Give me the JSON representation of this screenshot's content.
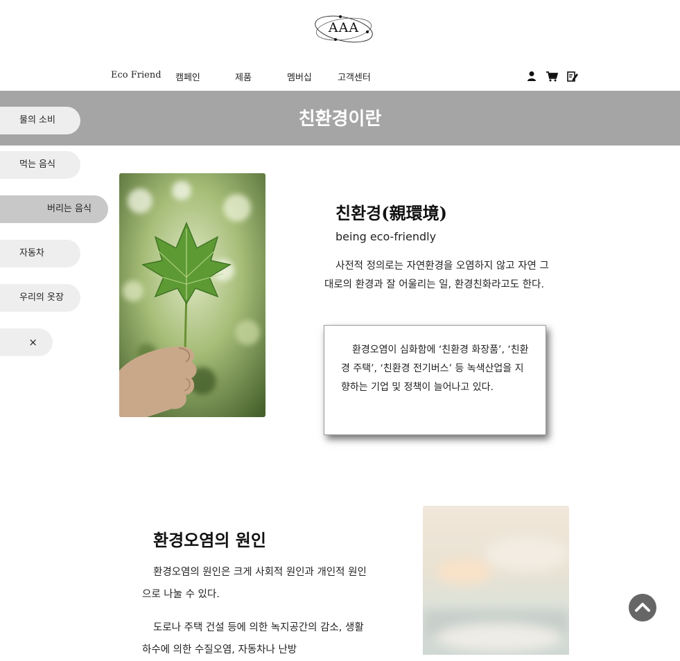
{
  "brand": {
    "logo_text": "AAA"
  },
  "nav": {
    "items": [
      {
        "label": "Eco Friend"
      },
      {
        "label": "캠페인"
      },
      {
        "label": "제품"
      },
      {
        "label": "멤버십"
      },
      {
        "label": "고객센터"
      }
    ],
    "utility_icons": [
      "user-icon",
      "cart-icon",
      "signup-icon"
    ]
  },
  "banner": {
    "title": "친환경이란"
  },
  "sidebar": {
    "items": [
      {
        "label": "물의 소비",
        "active": false
      },
      {
        "label": "먹는 음식",
        "active": false
      },
      {
        "label": "버리는 음식",
        "active": true
      },
      {
        "label": "자동차",
        "active": false
      },
      {
        "label": "우리의 옷장",
        "active": false
      }
    ],
    "close_label": "×"
  },
  "intro": {
    "title": "친환경(親環境)",
    "subtitle": "being eco-friendly",
    "definition": "사전적 정의로는 자연환경을 오염하지 않고 자연 그대로의 환경과 잘 어울리는 일, 환경친화라고도 한다.",
    "note": "환경오염이 심화함에 ‘친환경 화장품’, ‘친환경 주택’, ‘친환경 전기버스’ 등 녹색산업을 지향하는 기업 및 정책이 늘어나고 있다."
  },
  "causes": {
    "title": "환경오염의 원인",
    "paragraphs": [
      "환경오염의 원인은 크게 사회적 원인과 개인적 원인으로 나눌 수 있다.",
      "도로나 주택 건설 등에 의한 녹지공간의 감소, 생활하수에 의한 수질오염, 자동차나 난방"
    ]
  },
  "colors": {
    "banner": "#a5a5a5",
    "sidebar": "#eeeeee",
    "sidebar_active": "#c8c8c8",
    "scroll_top_button": "#666666"
  },
  "scroll_top": {
    "icon": "chevron-up-icon"
  }
}
